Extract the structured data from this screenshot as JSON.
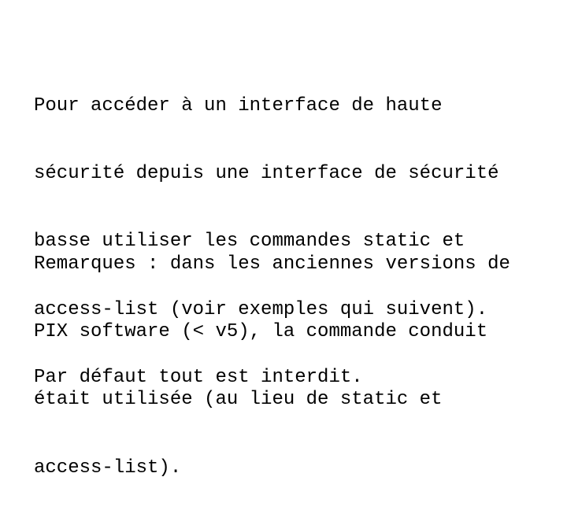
{
  "slide": {
    "paragraphs": [
      {
        "lines": [
          "Pour accéder à un interface de haute",
          "sécurité depuis une interface de sécurité",
          "basse utiliser les commandes static et",
          "access-list (voir exemples qui suivent).",
          "Par défaut tout est interdit."
        ]
      },
      {
        "lines": [
          "Remarques : dans les anciennes versions de",
          "PIX software (< v5), la commande conduit",
          "était utilisée (au lieu de static et",
          "access-list)."
        ]
      }
    ]
  }
}
